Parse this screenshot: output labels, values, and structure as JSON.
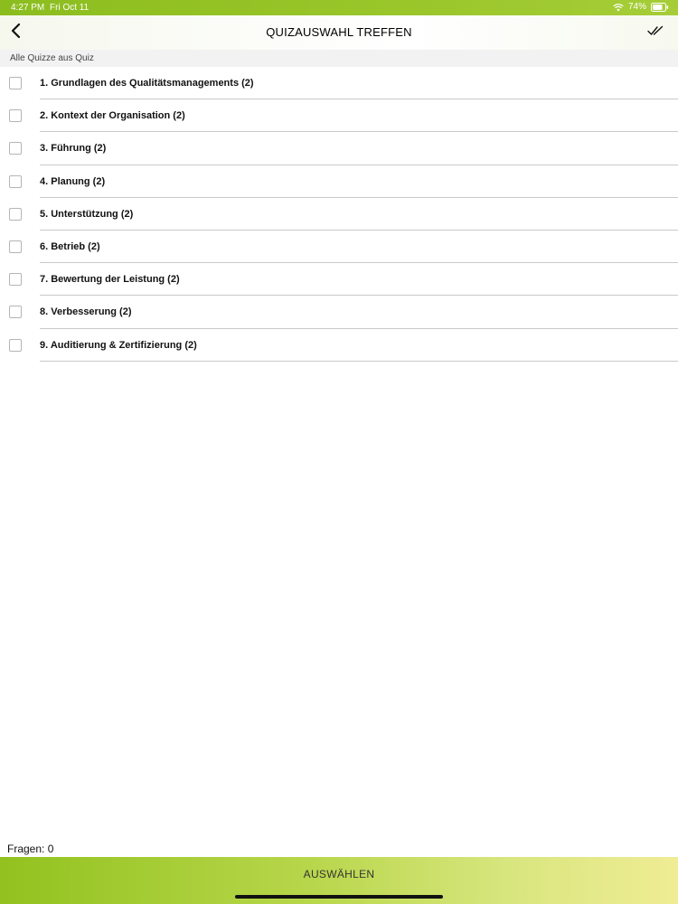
{
  "status_bar": {
    "time": "4:27 PM",
    "date": "Fri Oct 11",
    "battery": "74%",
    "icons": [
      "wifi-icon",
      "battery-icon"
    ]
  },
  "nav": {
    "back_icon": "chevron-left-icon",
    "title": "QUIZAUSWAHL TREFFEN",
    "select_all_icon": "double-check-icon"
  },
  "section": {
    "header": "Alle Quizze aus Quiz"
  },
  "quizzes": [
    {
      "label": "1. Grundlagen des Qualitätsmanagements (2)",
      "checked": false
    },
    {
      "label": "2. Kontext der Organisation (2)",
      "checked": false
    },
    {
      "label": "3. Führung (2)",
      "checked": false
    },
    {
      "label": "4. Planung (2)",
      "checked": false
    },
    {
      "label": "5. Unterstützung (2)",
      "checked": false
    },
    {
      "label": "6. Betrieb (2)",
      "checked": false
    },
    {
      "label": "7. Bewertung der Leistung (2)",
      "checked": false
    },
    {
      "label": "8. Verbesserung (2)",
      "checked": false
    },
    {
      "label": "9. Auditierung & Zertifizierung (2)",
      "checked": false
    }
  ],
  "footer": {
    "question_count": "Fragen: 0",
    "select_button": "AUSWÄHLEN"
  },
  "colors": {
    "brand_green": "#8cbd1f",
    "gradient_end": "#f0ec95"
  }
}
